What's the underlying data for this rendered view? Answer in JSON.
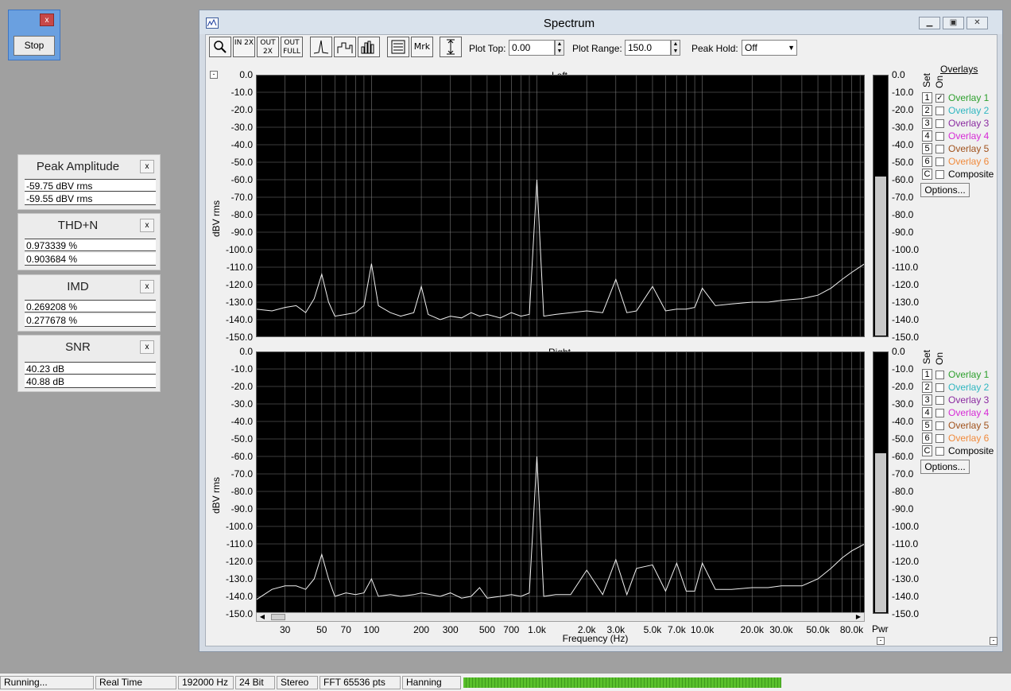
{
  "stop": {
    "label": "Stop",
    "close": "x"
  },
  "panels": [
    {
      "title": "Peak Amplitude",
      "v1": "-59.75 dBV rms",
      "v2": "-59.55 dBV rms"
    },
    {
      "title": "THD+N",
      "v1": "0.973339 %",
      "v2": "0.903684 %"
    },
    {
      "title": "IMD",
      "v1": "0.269208 %",
      "v2": "0.277678 %"
    },
    {
      "title": "SNR",
      "v1": "40.23 dB",
      "v2": "40.88 dB"
    }
  ],
  "window": {
    "title": "Spectrum"
  },
  "toolbar": {
    "zoom_in": "IN 2X",
    "zoom_out": "OUT 2X",
    "zoom_full": "OUT FULL",
    "marker": "Mrk",
    "plot_top_label": "Plot Top:",
    "plot_top_value": "0.00",
    "plot_range_label": "Plot Range:",
    "plot_range_value": "150.0",
    "peak_hold_label": "Peak Hold:",
    "peak_hold_value": "Off"
  },
  "plots": {
    "left_title": "Left",
    "right_title": "Right",
    "ylabel": "dBV rms",
    "xlabel": "Frequency (Hz)",
    "y_ticks": [
      "0.0",
      "-10.0",
      "-20.0",
      "-30.0",
      "-40.0",
      "-50.0",
      "-60.0",
      "-70.0",
      "-80.0",
      "-90.0",
      "-100.0",
      "-110.0",
      "-120.0",
      "-130.0",
      "-140.0",
      "-150.0"
    ],
    "x_ticks": [
      "30",
      "50",
      "70",
      "100",
      "200",
      "300",
      "500",
      "700",
      "1.0k",
      "2.0k",
      "3.0k",
      "5.0k",
      "7.0k",
      "10.0k",
      "20.0k",
      "30.0k",
      "50.0k",
      "80.0k"
    ],
    "pwr_label": "Pwr",
    "minus": "-"
  },
  "overlays": {
    "heading": "Overlays",
    "set": "Set",
    "on": "On",
    "options": "Options...",
    "items": [
      {
        "num": "1",
        "name": "Overlay 1",
        "color": "#2ea02e"
      },
      {
        "num": "2",
        "name": "Overlay 2",
        "color": "#2fb6c0"
      },
      {
        "num": "3",
        "name": "Overlay 3",
        "color": "#8a2aa0"
      },
      {
        "num": "4",
        "name": "Overlay 4",
        "color": "#d62ad6"
      },
      {
        "num": "5",
        "name": "Overlay 5",
        "color": "#a0521c"
      },
      {
        "num": "6",
        "name": "Overlay 6",
        "color": "#f08a3c"
      },
      {
        "num": "C",
        "name": "Composite",
        "color": "#000000"
      }
    ],
    "left_checked": "✓"
  },
  "chart_data": [
    {
      "type": "line",
      "title": "Left",
      "xlabel": "Frequency (Hz)",
      "ylabel": "dBV rms",
      "xscale": "log",
      "xlim": [
        20,
        96000
      ],
      "ylim": [
        -150,
        0
      ],
      "series": [
        {
          "points": [
            [
              20,
              -134
            ],
            [
              25,
              -135
            ],
            [
              30,
              -133
            ],
            [
              35,
              -132
            ],
            [
              40,
              -136
            ],
            [
              45,
              -128
            ],
            [
              50,
              -114
            ],
            [
              55,
              -130
            ],
            [
              60,
              -138
            ],
            [
              70,
              -137
            ],
            [
              80,
              -136
            ],
            [
              90,
              -132
            ],
            [
              100,
              -108
            ],
            [
              110,
              -132
            ],
            [
              130,
              -136
            ],
            [
              150,
              -138
            ],
            [
              180,
              -136
            ],
            [
              200,
              -121
            ],
            [
              220,
              -137
            ],
            [
              260,
              -140
            ],
            [
              300,
              -138
            ],
            [
              350,
              -139
            ],
            [
              400,
              -136
            ],
            [
              450,
              -138
            ],
            [
              500,
              -137
            ],
            [
              600,
              -139
            ],
            [
              700,
              -136
            ],
            [
              800,
              -138
            ],
            [
              900,
              -137
            ],
            [
              1000,
              -60
            ],
            [
              1100,
              -138
            ],
            [
              1300,
              -137
            ],
            [
              1600,
              -136
            ],
            [
              2000,
              -135
            ],
            [
              2500,
              -136
            ],
            [
              3000,
              -117
            ],
            [
              3500,
              -136
            ],
            [
              4000,
              -135
            ],
            [
              5000,
              -121
            ],
            [
              6000,
              -135
            ],
            [
              7000,
              -134
            ],
            [
              8000,
              -134
            ],
            [
              9000,
              -133
            ],
            [
              10000,
              -122
            ],
            [
              12000,
              -132
            ],
            [
              15000,
              -131
            ],
            [
              20000,
              -130
            ],
            [
              25000,
              -130
            ],
            [
              30000,
              -129
            ],
            [
              40000,
              -128
            ],
            [
              50000,
              -126
            ],
            [
              60000,
              -122
            ],
            [
              70000,
              -117
            ],
            [
              80000,
              -113
            ],
            [
              96000,
              -108
            ]
          ]
        }
      ]
    },
    {
      "type": "line",
      "title": "Right",
      "xlabel": "Frequency (Hz)",
      "ylabel": "dBV rms",
      "xscale": "log",
      "xlim": [
        20,
        96000
      ],
      "ylim": [
        -150,
        0
      ],
      "series": [
        {
          "points": [
            [
              20,
              -142
            ],
            [
              25,
              -136
            ],
            [
              30,
              -134
            ],
            [
              35,
              -134
            ],
            [
              40,
              -136
            ],
            [
              45,
              -130
            ],
            [
              50,
              -116
            ],
            [
              55,
              -130
            ],
            [
              60,
              -140
            ],
            [
              70,
              -138
            ],
            [
              80,
              -139
            ],
            [
              90,
              -138
            ],
            [
              100,
              -130
            ],
            [
              110,
              -140
            ],
            [
              130,
              -139
            ],
            [
              150,
              -140
            ],
            [
              180,
              -139
            ],
            [
              200,
              -138
            ],
            [
              260,
              -140
            ],
            [
              300,
              -138
            ],
            [
              350,
              -141
            ],
            [
              400,
              -140
            ],
            [
              450,
              -135
            ],
            [
              500,
              -141
            ],
            [
              600,
              -140
            ],
            [
              700,
              -139
            ],
            [
              800,
              -140
            ],
            [
              900,
              -138
            ],
            [
              1000,
              -60
            ],
            [
              1100,
              -140
            ],
            [
              1300,
              -139
            ],
            [
              1600,
              -139
            ],
            [
              2000,
              -125
            ],
            [
              2500,
              -139
            ],
            [
              3000,
              -119
            ],
            [
              3500,
              -139
            ],
            [
              4000,
              -124
            ],
            [
              5000,
              -122
            ],
            [
              6000,
              -137
            ],
            [
              7000,
              -121
            ],
            [
              8000,
              -137
            ],
            [
              9000,
              -137
            ],
            [
              10000,
              -121
            ],
            [
              12000,
              -136
            ],
            [
              15000,
              -136
            ],
            [
              20000,
              -135
            ],
            [
              25000,
              -135
            ],
            [
              30000,
              -134
            ],
            [
              40000,
              -134
            ],
            [
              50000,
              -130
            ],
            [
              60000,
              -124
            ],
            [
              70000,
              -118
            ],
            [
              80000,
              -114
            ],
            [
              96000,
              -110
            ]
          ]
        }
      ]
    }
  ],
  "status": {
    "state": "Running...",
    "mode": "Real Time",
    "rate": "192000 Hz",
    "bits": "24 Bit",
    "channels": "Stereo",
    "fft": "FFT 65536 pts",
    "window": "Hanning"
  },
  "meter": {
    "left_pwr_fraction": 0.61,
    "right_pwr_fraction": 0.61
  }
}
